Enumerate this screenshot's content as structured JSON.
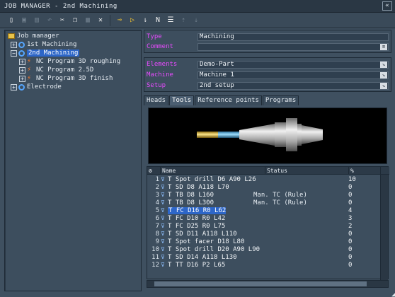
{
  "window": {
    "title": "JOB MANAGER - 2nd Machining",
    "control": "«"
  },
  "toolbar": {
    "icons": [
      "new-doc-icon",
      "save-icon",
      "save-all-icon",
      "undo-icon",
      "cut-icon",
      "copy-icon",
      "paste-icon",
      "delete-icon",
      "feed-icon",
      "play-icon",
      "probe-icon",
      "nc-icon",
      "report-icon",
      "move-up-icon",
      "move-down-icon"
    ]
  },
  "tree": {
    "root": "Job manager",
    "items": [
      "1st Machining",
      "2nd Machining",
      "NC Program 3D roughing",
      "NC Program 2.5D",
      "NC Program 3D finish",
      "Electrode"
    ]
  },
  "properties": {
    "type": {
      "label": "Type",
      "value": "Machining"
    },
    "comment": {
      "label": "Comment",
      "value": ""
    },
    "elements": {
      "label": "Elements",
      "value": "Demo-Part"
    },
    "machine": {
      "label": "Machine",
      "value": "Machine 1"
    },
    "setup": {
      "label": "Setup",
      "value": "2nd setup"
    }
  },
  "tabs": [
    "Heads",
    "Tools",
    "Reference points",
    "Programs"
  ],
  "active_tab": "Tools",
  "tool_list": {
    "headers": {
      "name": "Name",
      "status": "Status",
      "count": "%"
    },
    "rows": [
      {
        "num": "1",
        "name": "T Spot drill D6 A90 L26",
        "status": "",
        "count": "10"
      },
      {
        "num": "2",
        "name": "T SD D8 A118 L70",
        "status": "",
        "count": "0"
      },
      {
        "num": "3",
        "name": "T TB D8 L160",
        "status": "Man. TC (Rule)",
        "count": "0"
      },
      {
        "num": "4",
        "name": "T TB D8 L300",
        "status": "Man. TC (Rule)",
        "count": "0"
      },
      {
        "num": "5",
        "name": "T FC D16 R0 L62",
        "status": "",
        "count": "4"
      },
      {
        "num": "6",
        "name": "T FC D10 R0 L42",
        "status": "",
        "count": "3"
      },
      {
        "num": "7",
        "name": "T FC D25 R0 L75",
        "status": "",
        "count": "2"
      },
      {
        "num": "8",
        "name": "T SD D11 A118 L110",
        "status": "",
        "count": "0"
      },
      {
        "num": "9",
        "name": "T Spot facer D18 L80",
        "status": "",
        "count": "0"
      },
      {
        "num": "10",
        "name": "T Spot drill D20 A90 L90",
        "status": "",
        "count": "0"
      },
      {
        "num": "11",
        "name": "T SD D14 A118 L130",
        "status": "",
        "count": "0"
      },
      {
        "num": "12",
        "name": "T TT D16 P2 L65",
        "status": "",
        "count": "0"
      }
    ]
  },
  "colors": {
    "accent": "#2d66c8",
    "label": "#e84bff",
    "bg": "#3f5060"
  }
}
